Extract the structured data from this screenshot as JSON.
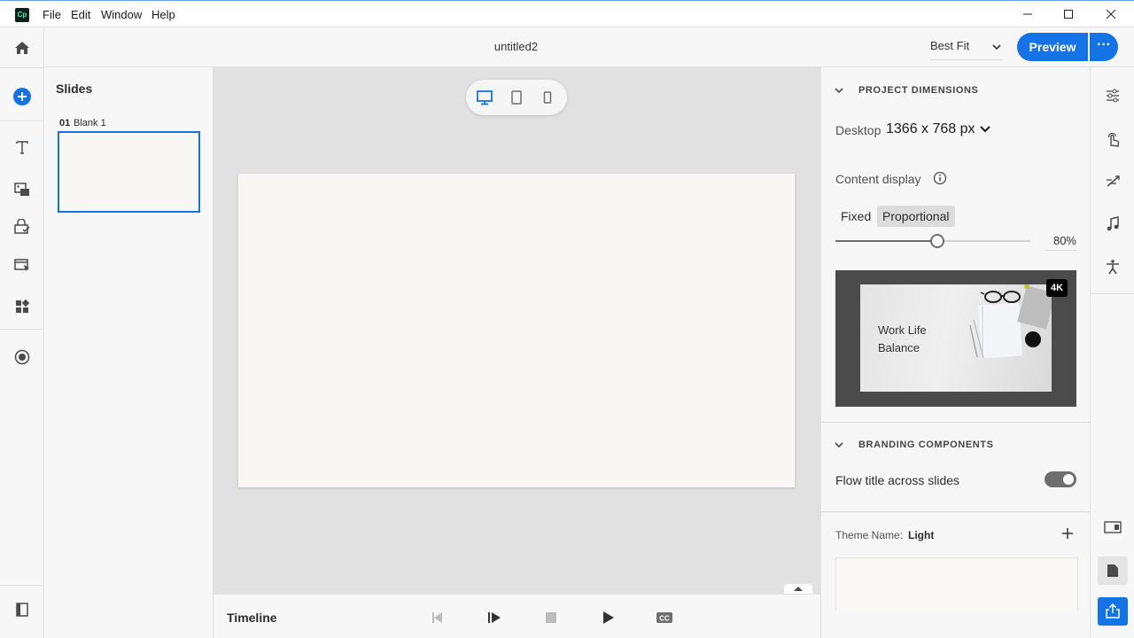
{
  "app": {
    "logo_text": "Cp",
    "title": "untitled2"
  },
  "menu": [
    "File",
    "Edit",
    "Window",
    "Help"
  ],
  "header": {
    "zoom_value": "Best Fit",
    "preview_label": "Preview",
    "more_label": "···"
  },
  "slides": {
    "title": "Slides",
    "items": [
      {
        "number": "01",
        "name": "Blank 1"
      }
    ]
  },
  "timeline": {
    "label": "Timeline"
  },
  "properties": {
    "project_dimensions": {
      "heading": "PROJECT DIMENSIONS",
      "device": "Desktop",
      "size": "1366 x 768 px",
      "content_display_label": "Content display",
      "mode_fixed": "Fixed",
      "mode_proportional": "Proportional",
      "selected_mode": "Proportional",
      "scale_percent": 80,
      "scale_text": "80%",
      "preview_title": "Work Life Balance",
      "preview_badge": "4K"
    },
    "branding": {
      "heading": "BRANDING COMPONENTS",
      "flow_title_label": "Flow title across slides",
      "flow_title_on": true,
      "theme_label": "Theme Name:",
      "theme_value": "Light"
    }
  },
  "colors": {
    "accent": "#1473e6",
    "canvas_bg": "#e1e1e1",
    "slide_bg": "#f8f7f3"
  }
}
